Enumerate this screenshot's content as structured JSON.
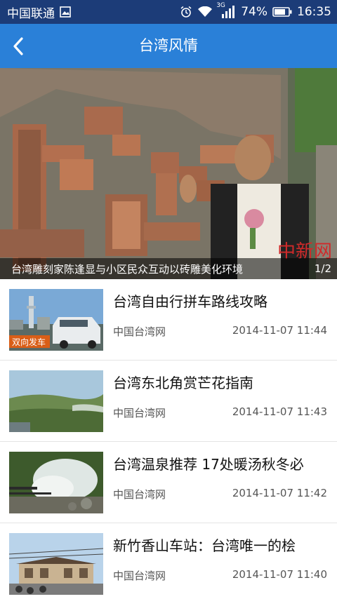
{
  "status": {
    "carrier": "中国联通",
    "network": "3G",
    "battery": "74%",
    "time": "16:35"
  },
  "header": {
    "title": "台湾风情"
  },
  "banner": {
    "caption": "台湾雕刻家陈逢显与小区民众互动以砖雕美化环境",
    "pager": "1/2",
    "watermark": "中新网"
  },
  "articles": [
    {
      "title": "台湾自由行拼车路线攻略",
      "source": "中国台湾网",
      "time": "2014-11-07 11:44",
      "thumb_label": "双向发车"
    },
    {
      "title": "台湾东北角赏芒花指南",
      "source": "中国台湾网",
      "time": "2014-11-07 11:43"
    },
    {
      "title": "台湾温泉推荐 17处暖汤秋冬必",
      "source": "中国台湾网",
      "time": "2014-11-07 11:42"
    },
    {
      "title": "新竹香山车站：台湾唯一的桧",
      "source": "中国台湾网",
      "time": "2014-11-07 11:40"
    }
  ],
  "colors": {
    "status_bar": "#1c3c78",
    "app_bar": "#2a80d8"
  }
}
